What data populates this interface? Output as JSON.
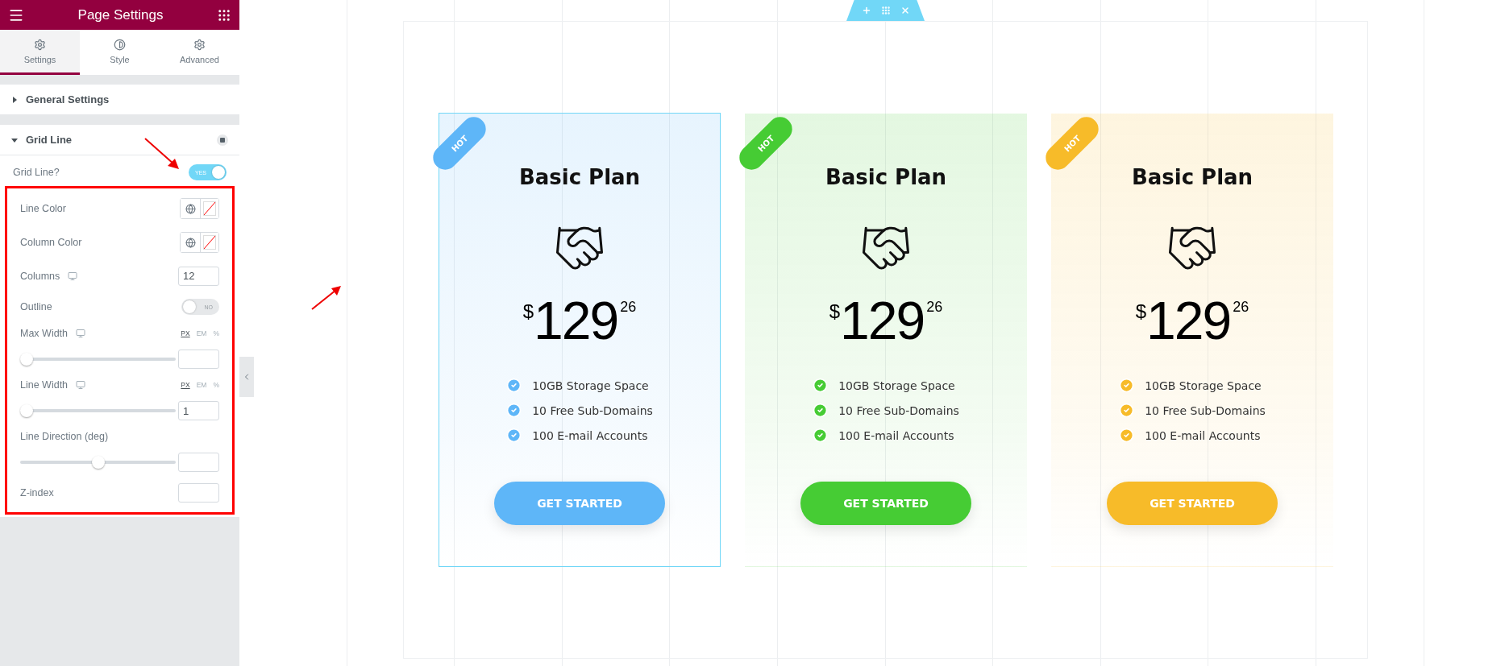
{
  "panel": {
    "title": "Page Settings",
    "tabs": [
      {
        "label": "Settings",
        "selected": true
      },
      {
        "label": "Style",
        "selected": false
      },
      {
        "label": "Advanced",
        "selected": false
      }
    ],
    "sections": [
      {
        "title": "General Settings",
        "expanded": false
      },
      {
        "title": "Grid Line",
        "expanded": true,
        "toggle": {
          "label": "Grid Line?",
          "on": true,
          "text": "YES"
        },
        "highlighted_controls": [
          {
            "kind": "color",
            "label": "Line Color"
          },
          {
            "kind": "color",
            "label": "Column Color"
          },
          {
            "kind": "number",
            "label": "Columns",
            "responsive": true,
            "value": "12"
          },
          {
            "kind": "toggle",
            "label": "Outline",
            "on": false,
            "text": "NO"
          },
          {
            "kind": "slider",
            "label": "Max Width",
            "responsive": true,
            "units": [
              {
                "label": "PX",
                "selected": true
              },
              {
                "label": "EM",
                "selected": false
              },
              {
                "label": "%",
                "selected": false
              }
            ],
            "level": 0
          },
          {
            "kind": "slider",
            "label": "Line Width",
            "responsive": true,
            "units": [
              {
                "label": "PX",
                "selected": true
              },
              {
                "label": "EM",
                "selected": false
              },
              {
                "label": "%",
                "selected": false
              }
            ],
            "level": 0,
            "value": "1"
          },
          {
            "kind": "slider",
            "label": "Line Direction (deg)",
            "responsive": false,
            "level": 0.5
          },
          {
            "kind": "number",
            "label": "Z-index",
            "responsive": false
          }
        ]
      }
    ]
  },
  "cards": [
    {
      "badge": "HOT",
      "title": "Basic Plan",
      "currency": "$",
      "price": "129",
      "cents": "26",
      "color": "#5eb6f8",
      "selected": true,
      "features": [
        "10GB Storage Space",
        "10 Free Sub-Domains",
        "100 E-mail Accounts"
      ],
      "button": "GET STARTED"
    },
    {
      "badge": "HOT",
      "title": "Basic Plan",
      "currency": "$",
      "price": "129",
      "cents": "26",
      "color": "#46cc34",
      "selected": false,
      "features": [
        "10GB Storage Space",
        "10 Free Sub-Domains",
        "100 E-mail Accounts"
      ],
      "button": "GET STARTED"
    },
    {
      "badge": "HOT",
      "title": "Basic Plan",
      "currency": "$",
      "price": "129",
      "cents": "26",
      "color": "#f7bb29",
      "selected": false,
      "features": [
        "10GB Storage Space",
        "10 Free Sub-Domains",
        "100 E-mail Accounts"
      ],
      "button": "GET STARTED"
    }
  ]
}
